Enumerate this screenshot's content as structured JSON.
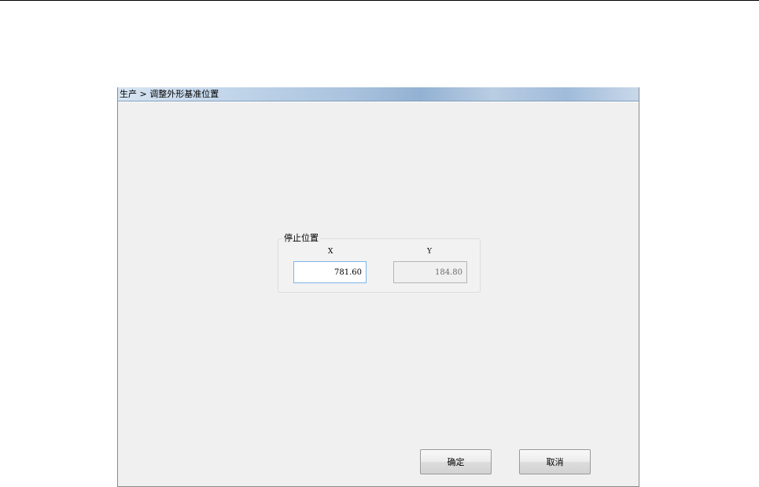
{
  "window": {
    "title": "生产 > 调整外形基准位置"
  },
  "stop_position": {
    "group_title": "停止位置",
    "x_label": "X",
    "y_label": "Y",
    "x_value": "781.60",
    "y_value": "184.80"
  },
  "buttons": {
    "ok_label": "确定",
    "cancel_label": "取消"
  }
}
